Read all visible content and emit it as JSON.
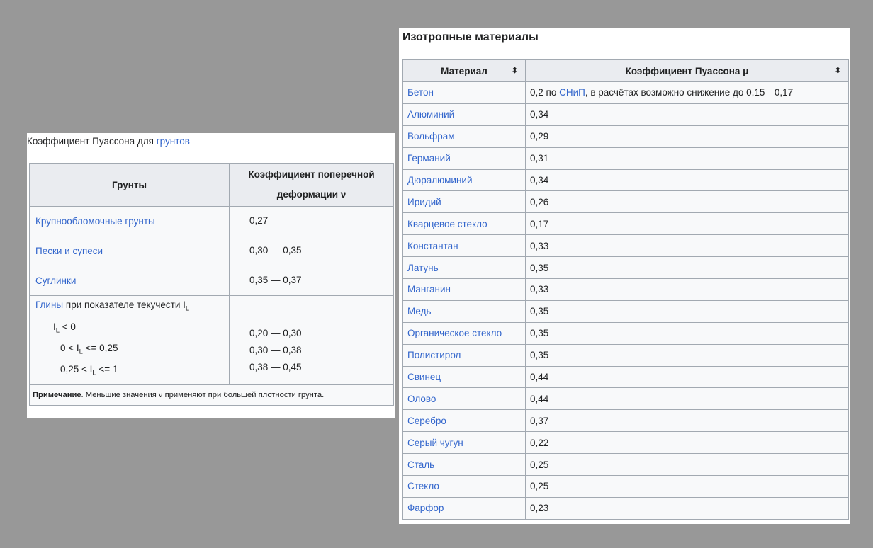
{
  "soil_table": {
    "caption_prefix": "Коэффициент Пуассона для",
    "caption_link": "грунтов",
    "header_name": "Грунты",
    "header_coef": "Коэффициент поперечной деформации ν",
    "rows": [
      {
        "name": "Крупнообломочные грунты",
        "value": "0,27"
      },
      {
        "name": "Пески и супеси",
        "value": "0,30 — 0,35"
      },
      {
        "name": "Суглинки",
        "value": "0,35 — 0,37"
      }
    ],
    "clay_link": "Глины",
    "clay_text": "при показателе текучести I",
    "clay_sub": "L",
    "clay_conditions": [
      {
        "pre": "I",
        "sub": "L",
        "post": " < 0",
        "value": "0,20 — 0,30"
      },
      {
        "pre": "0 < I",
        "sub": "L",
        "post": " <= 0,25",
        "value": "0,30 — 0,38"
      },
      {
        "pre": "0,25 < I",
        "sub": "L",
        "post": " <= 1",
        "value": "0,38 — 0,45"
      }
    ],
    "note_bold": "Примечание",
    "note_text": ". Меньшие значения ν применяют при большей плотности грунта."
  },
  "iso_table": {
    "caption": "Изотропные материалы",
    "header_material": "Материал",
    "header_coef": "Коэффициент Пуассона μ",
    "sort_icon": "⬍",
    "first_row": {
      "material": "Бетон",
      "value_pre": "0,2 по",
      "value_link": "СНиП",
      "value_post": ", в расчётах возможно снижение до 0,15—0,17"
    },
    "rows": [
      {
        "material": "Алюминий",
        "value": "0,34"
      },
      {
        "material": "Вольфрам",
        "value": "0,29"
      },
      {
        "material": "Германий",
        "value": "0,31"
      },
      {
        "material": "Дюралюминий",
        "value": "0,34"
      },
      {
        "material": "Иридий",
        "value": "0,26"
      },
      {
        "material": "Кварцевое стекло",
        "value": "0,17"
      },
      {
        "material": "Константан",
        "value": "0,33"
      },
      {
        "material": "Латунь",
        "value": "0,35"
      },
      {
        "material": "Манганин",
        "value": "0,33"
      },
      {
        "material": "Медь",
        "value": "0,35"
      },
      {
        "material": "Органическое стекло",
        "value": "0,35"
      },
      {
        "material": "Полистирол",
        "value": "0,35"
      },
      {
        "material": "Свинец",
        "value": "0,44"
      },
      {
        "material": "Олово",
        "value": "0,44"
      },
      {
        "material": "Серебро",
        "value": "0,37"
      },
      {
        "material": "Серый чугун",
        "value": "0,22"
      },
      {
        "material": "Сталь",
        "value": "0,25"
      },
      {
        "material": "Стекло",
        "value": "0,25"
      },
      {
        "material": "Фарфор",
        "value": "0,23"
      }
    ]
  }
}
